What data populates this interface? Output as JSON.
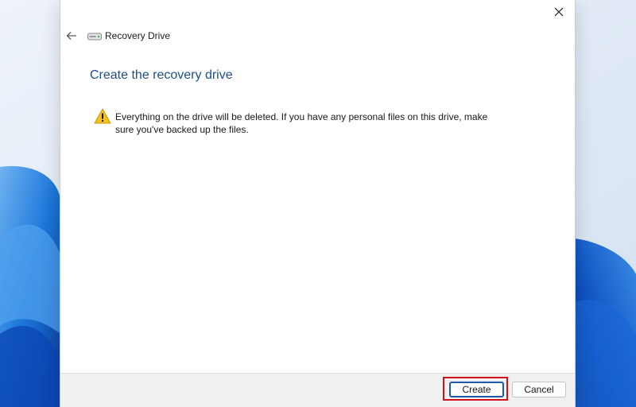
{
  "window": {
    "title": "Recovery Drive",
    "heading": "Create the recovery drive",
    "warning": "Everything on the drive will be deleted. If you have any personal files on this drive, make sure you've backed up the files."
  },
  "footer": {
    "create_label": "Create",
    "cancel_label": "Cancel"
  },
  "icons": {
    "close": "close-icon",
    "back": "back-arrow-icon",
    "drive": "drive-icon",
    "warning": "warning-icon"
  },
  "colors": {
    "heading": "#1e4e8c",
    "primary_button_border": "#1d5aa8",
    "highlight": "#d0101b",
    "warning": "#f4c21b"
  }
}
